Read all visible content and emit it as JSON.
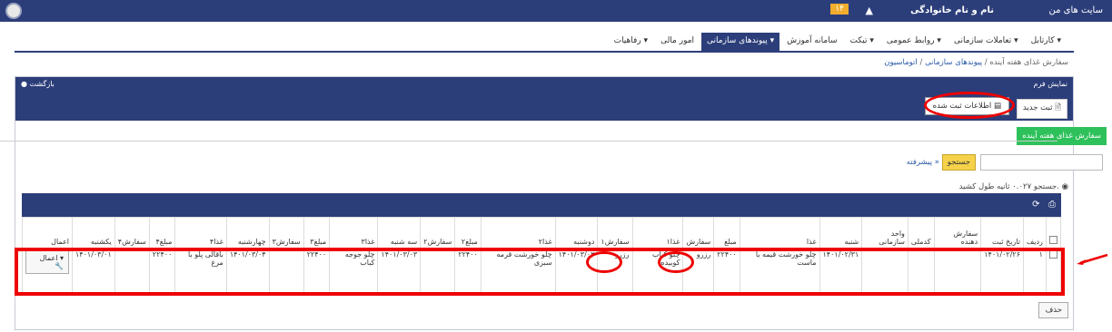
{
  "topbar": {
    "user_name": "نام و نام خانوادگی",
    "notif_count": "۱۴",
    "my_sites": "سایت های من"
  },
  "menu": [
    {
      "label": "کارتابل ▾"
    },
    {
      "label": "تعاملات سازمانی ▾"
    },
    {
      "label": "روابط عمومی ▾"
    },
    {
      "label": "تیکت ▾"
    },
    {
      "label": "سامانه آموزش"
    },
    {
      "label": "پیوندهای سازمانی ▾",
      "active": true
    },
    {
      "label": "امور مالی"
    },
    {
      "label": "رفاهیات ▾"
    }
  ],
  "breadcrumb": {
    "item1": "اتوماسیون",
    "item2": "پیوندهای سازمانی",
    "item3": "سفارش غذای هفته آینده",
    "sep": "/"
  },
  "panel": {
    "title": "نمایش فرم",
    "back": "بازگشت",
    "new_btn": "ثبت جدید",
    "info_btn": "اطلاعات ثبت شده",
    "green_tab": "سفارش غذای هفته آینده"
  },
  "search": {
    "button": "جستجو",
    "advanced": "پیشرفته »",
    "timing": "جستجو ۰.۰۲۷ ثانیه طول کشید."
  },
  "table": {
    "headers": [
      "ردیف",
      "تاریخ ثبت",
      "سفارش دهنده",
      "کدملی",
      "واحد سازمانی",
      "شنبه",
      "غذا",
      "مبلغ",
      "سفارش",
      "غذا۱",
      "سفارش۱",
      "دوشنبه",
      "غذا۲",
      "مبلغ۲",
      "سفارش۲",
      "سه شنبه",
      "غذا۳",
      "مبلغ۳",
      "سفارش۳",
      "چهارشنبه",
      "غذا۴",
      "مبلغ۴",
      "سفارش۴",
      "یکشنبه",
      "اعمال"
    ],
    "row": {
      "idx": "۱",
      "reg_date": "۱۴۰۱/۰۲/۲۶",
      "orderer": "",
      "national_id": "",
      "unit": "",
      "saturday": "۱۴۰۱/۰۲/۳۱",
      "food": "چلو خورشت قیمه با ماست",
      "price": "۲۲۴۰۰",
      "order": "رزرو",
      "food1": "چلو کباب کوبیده",
      "order1": "رزرو",
      "monday": "۱۴۰۱/۰۳/۰۲",
      "food2": "چلو خورشت قرمه سبزی",
      "price2": "۲۲۴۰۰",
      "order2": "",
      "tuesday": "۱۴۰۱/۰۳/۰۳",
      "food3": "چلو جوجه کباب",
      "price3": "۲۲۴۰۰",
      "order3": "",
      "wednesday": "۱۴۰۱/۰۳/۰۴",
      "food4": "باقالی پلو با مرغ",
      "price4": "۲۲۴۰۰",
      "order4": "",
      "sunday": "۱۴۰۱/۰۳/۰۱",
      "action": "اعمال ▾"
    }
  },
  "delete_btn": "حذف"
}
